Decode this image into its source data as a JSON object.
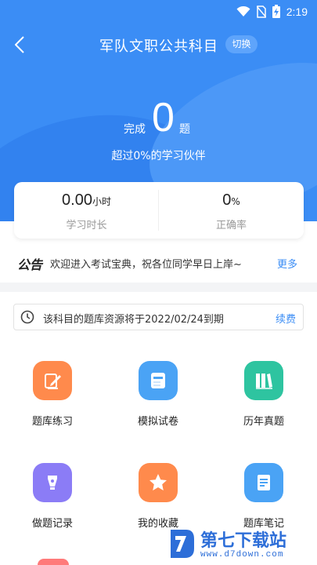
{
  "status_bar": {
    "time": "2:19",
    "icons": [
      "wifi-icon",
      "no-sim-icon",
      "battery-charging-icon"
    ]
  },
  "nav": {
    "back_icon": "chevron-left-icon",
    "title": "军队文职公共科目",
    "switch_label": "切换"
  },
  "progress": {
    "done_label": "完成",
    "done_count": "0",
    "done_unit": "题",
    "beat_text": "超过0%的学习伙伴"
  },
  "stats": {
    "study_time_value": "0.00",
    "study_time_unit": "小时",
    "study_time_label": "学习时长",
    "accuracy_value": "0",
    "accuracy_unit": "%",
    "accuracy_label": "正确率"
  },
  "notice": {
    "tag": "公告",
    "text": "欢迎进入考试宝典，祝各位同学早日上岸~",
    "more": "更多"
  },
  "expiry": {
    "text": "该科目的题库资源将于2022/02/24到期",
    "renew": "续费"
  },
  "grid": [
    {
      "label": "题库练习",
      "icon": "pen-paper-icon",
      "color": "#ff8a4c"
    },
    {
      "label": "模拟试卷",
      "icon": "test-paper-icon",
      "color": "#4aa3f5"
    },
    {
      "label": "历年真题",
      "icon": "books-icon",
      "color": "#2ec4a0"
    },
    {
      "label": "做题记录",
      "icon": "fountain-pen-icon",
      "color": "#8b7cf6"
    },
    {
      "label": "我的收藏",
      "icon": "star-icon",
      "color": "#ff8a4c"
    },
    {
      "label": "题库笔记",
      "icon": "notes-icon",
      "color": "#4aa3f5"
    }
  ],
  "watermark": {
    "title": "第七下载站",
    "url": "www.d7down.com"
  },
  "colors": {
    "primary": "#3b8df5",
    "notice_tag": "#222222"
  }
}
